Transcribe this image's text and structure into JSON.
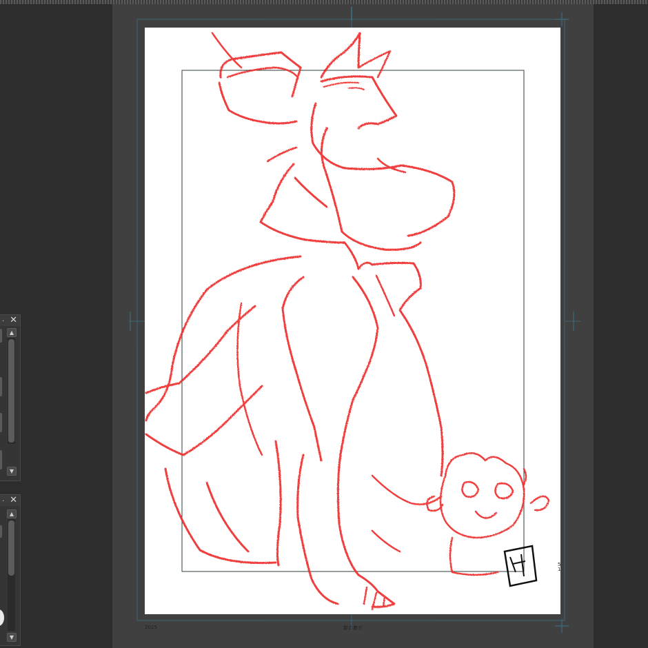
{
  "canvas": {
    "footer_left": "2025",
    "footer_center": "新の着せ",
    "footer_right_top": "5",
    "footer_right_bottom": "1",
    "signature": "Aku Tomo",
    "sketch_color": "#ee2a2a",
    "page_color": "#ffffff",
    "workspace_color": "#404040"
  },
  "panels": {
    "panel_a": {
      "close_symbol": "✕",
      "menu_symbol": "."
    },
    "panel_b": {
      "close_symbol": "✕",
      "menu_symbol": "."
    }
  },
  "scroll": {
    "up_symbol": "▲",
    "down_symbol": "▼"
  },
  "icons": [
    "close-icon",
    "chevron-up-icon",
    "chevron-down-icon",
    "guide-cross-icon"
  ]
}
